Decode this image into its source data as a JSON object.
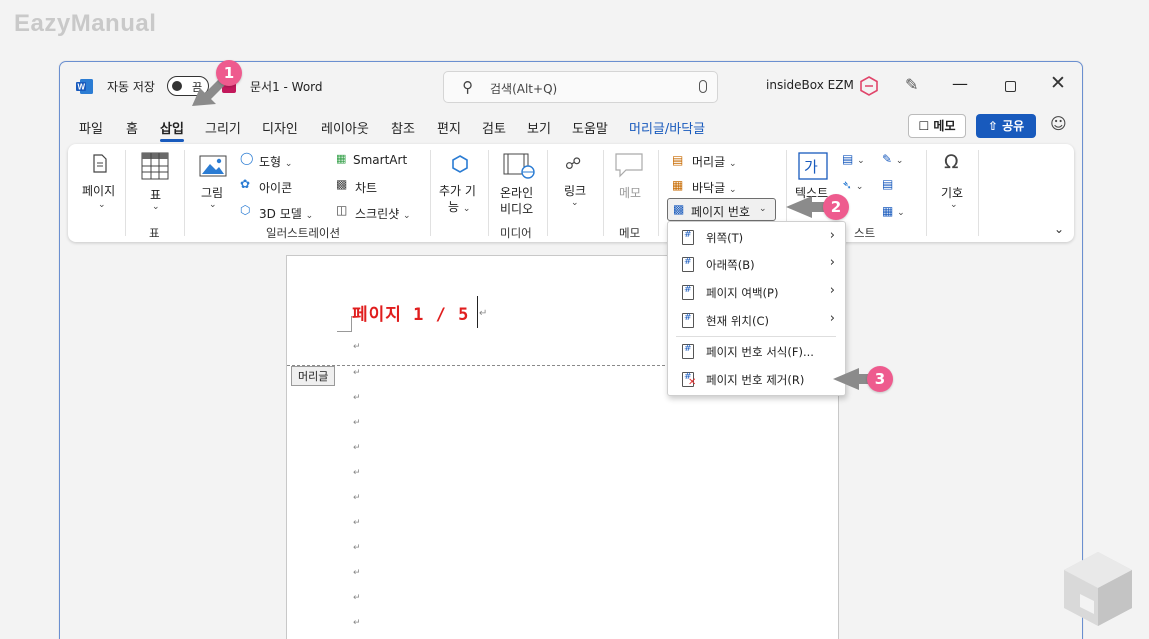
{
  "watermark": "EazyManual",
  "titlebar": {
    "autosave_label": "자동 저장",
    "autosave_state": "끔",
    "doc_title": "문서1 - Word",
    "search_placeholder": "검색(Alt+Q)",
    "user_name": "insideBox EZM"
  },
  "menu": {
    "items": [
      "파일",
      "홈",
      "삽입",
      "그리기",
      "디자인",
      "레이아웃",
      "참조",
      "편지",
      "검토",
      "보기",
      "도움말",
      "머리글/바닥글"
    ],
    "active": "삽입",
    "memo_btn": "메모",
    "share_btn": "공유"
  },
  "ribbon": {
    "pages": "페이지",
    "table": "표",
    "table_group": "표",
    "picture": "그림",
    "shapes": "도형",
    "icons": "아이콘",
    "model3d": "3D 모델",
    "smartart": "SmartArt",
    "chart": "차트",
    "screenshot": "스크린샷",
    "illust_group": "일러스트레이션",
    "addins_1": "추가 기",
    "addins_2": "능",
    "online_video_1": "온라인",
    "online_video_2": "비디오",
    "media_group": "미디어",
    "link": "링크",
    "comment": "메모",
    "comment_group": "메모",
    "header": "머리글",
    "footer": "바닥글",
    "page_number": "페이지 번호",
    "text": "텍스트",
    "text_group_partial": "스트",
    "symbol": "기호"
  },
  "document": {
    "header_content": "페이지 1 / 5",
    "header_tag": "머리글"
  },
  "dropdown": {
    "items": [
      {
        "label": "위쪽(T)",
        "submenu": true
      },
      {
        "label": "아래쪽(B)",
        "submenu": true
      },
      {
        "label": "페이지 여백(P)",
        "submenu": true
      },
      {
        "label": "현재 위치(C)",
        "submenu": true
      },
      {
        "label": "페이지 번호 서식(F)...",
        "submenu": false
      },
      {
        "label": "페이지 번호 제거(R)",
        "submenu": false
      }
    ]
  },
  "callouts": [
    "1",
    "2",
    "3"
  ],
  "colors": {
    "accent": "#185abd",
    "header_text": "#e01e1e",
    "callout": "#ee5b8e",
    "arrow": "#8b8b8b"
  }
}
